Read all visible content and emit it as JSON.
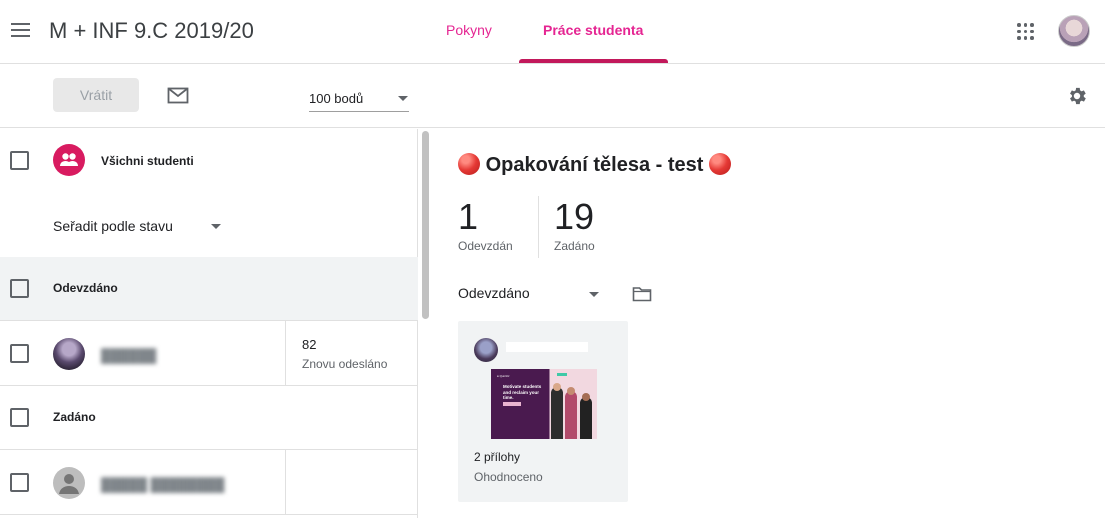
{
  "header": {
    "class_title": "M + INF 9.C 2019/20",
    "tabs": [
      {
        "label": "Pokyny",
        "active": false
      },
      {
        "label": "Práce studenta",
        "active": true
      }
    ],
    "accent_color": "#e52592"
  },
  "toolbar": {
    "return_label": "Vrátit",
    "points_value": "100 bodů"
  },
  "roster": {
    "all_students_label": "Všichni studenti",
    "sort_label": "Seřadit podle stavu",
    "sections": [
      {
        "label": "Odevzdáno",
        "students": [
          {
            "grade": "82",
            "status": "Znovu odesláno"
          }
        ]
      },
      {
        "label": "Zadáno",
        "students": [
          {
            "grade": "",
            "status": ""
          }
        ]
      }
    ]
  },
  "assignment": {
    "title": "Opakování tělesa - test",
    "stats": [
      {
        "value": "1",
        "label": "Odevzdán"
      },
      {
        "value": "19",
        "label": "Zadáno"
      }
    ],
    "filter_value": "Odevzdáno",
    "card": {
      "attachments": "2 přílohy",
      "status": "Ohodnoceno",
      "thumbnail_text": "Motivate students and reclaim your time."
    }
  }
}
